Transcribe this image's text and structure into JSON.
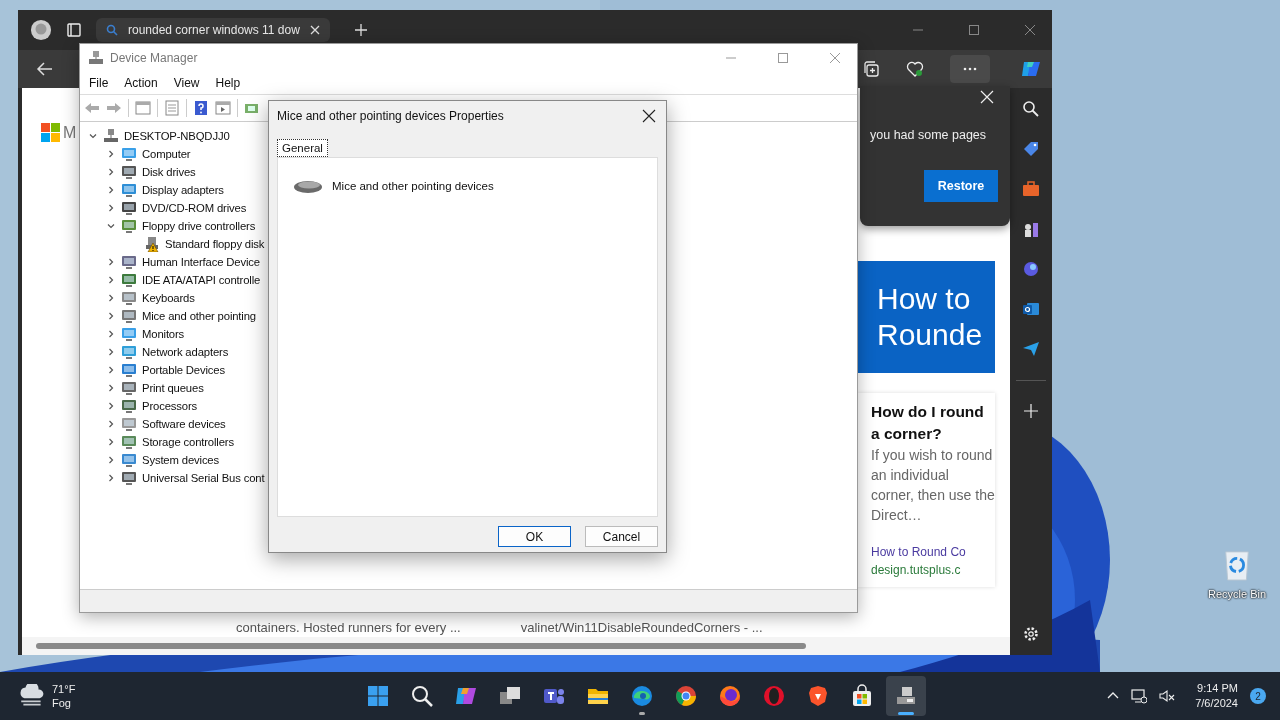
{
  "browser": {
    "tab": {
      "title": "rounded corner windows 11 dow"
    },
    "restore_popup": {
      "message": "you had some pages",
      "button": "Restore"
    },
    "page": {
      "logo_letter": "M",
      "hero_lines": [
        "How to",
        "Rounde"
      ],
      "card": {
        "question": "How do I round a corner?",
        "snippet": "If you wish to round an individual corner, then use the Direct…",
        "link": "How to Round Co",
        "source": "design.tutsplus.c"
      },
      "bottom_snippets": [
        "containers. Hosted runners for every ...",
        "valinet/Win11DisableRoundedCorners - ..."
      ]
    }
  },
  "device_manager": {
    "title": "Device Manager",
    "menu": [
      "File",
      "Action",
      "View",
      "Help"
    ],
    "tree": {
      "label": "DESKTOP-NBQDJJ0",
      "expanded": true,
      "children": [
        {
          "label": "Computer",
          "expanded": false
        },
        {
          "label": "Disk drives",
          "expanded": false
        },
        {
          "label": "Display adapters",
          "expanded": false
        },
        {
          "label": "DVD/CD-ROM drives",
          "expanded": false
        },
        {
          "label": "Floppy drive controllers",
          "expanded": true,
          "children": [
            {
              "label": "Standard floppy disk",
              "warning": true
            }
          ]
        },
        {
          "label": "Human Interface Device",
          "expanded": false
        },
        {
          "label": "IDE ATA/ATAPI controlle",
          "expanded": false
        },
        {
          "label": "Keyboards",
          "expanded": false
        },
        {
          "label": "Mice and other pointing",
          "expanded": false
        },
        {
          "label": "Monitors",
          "expanded": false
        },
        {
          "label": "Network adapters",
          "expanded": false
        },
        {
          "label": "Portable Devices",
          "expanded": false
        },
        {
          "label": "Print queues",
          "expanded": false
        },
        {
          "label": "Processors",
          "expanded": false
        },
        {
          "label": "Software devices",
          "expanded": false
        },
        {
          "label": "Storage controllers",
          "expanded": false
        },
        {
          "label": "System devices",
          "expanded": false
        },
        {
          "label": "Universal Serial Bus cont",
          "expanded": false
        }
      ]
    }
  },
  "properties_dialog": {
    "title": "Mice and other pointing devices Properties",
    "tabs": [
      {
        "label": "General",
        "selected": true
      }
    ],
    "device_name": "Mice and other pointing devices",
    "buttons": [
      {
        "label": "OK",
        "default": true
      },
      {
        "label": "Cancel",
        "default": false
      }
    ]
  },
  "desktop": {
    "icons": [
      {
        "label": "Recycle Bin"
      }
    ]
  },
  "taskbar": {
    "weather": {
      "temperature": "71°F",
      "condition": "Fog"
    },
    "apps": [
      {
        "kind": "start",
        "running": false,
        "selected": false
      },
      {
        "kind": "search",
        "running": false,
        "selected": false
      },
      {
        "kind": "copilot",
        "running": false,
        "selected": false
      },
      {
        "kind": "taskview",
        "running": false,
        "selected": false
      },
      {
        "kind": "teams",
        "running": false,
        "selected": false
      },
      {
        "kind": "explorer",
        "running": false,
        "selected": false
      },
      {
        "kind": "edge",
        "running": true,
        "selected": false
      },
      {
        "kind": "chrome",
        "running": false,
        "selected": false
      },
      {
        "kind": "firefox",
        "running": false,
        "selected": false
      },
      {
        "kind": "opera",
        "running": false,
        "selected": false
      },
      {
        "kind": "brave",
        "running": false,
        "selected": false
      },
      {
        "kind": "store",
        "running": false,
        "selected": false
      },
      {
        "kind": "devmgr",
        "running": true,
        "selected": true
      }
    ],
    "clock": {
      "time": "9:14 PM",
      "date": "7/6/2024"
    },
    "notification_count": "2"
  }
}
